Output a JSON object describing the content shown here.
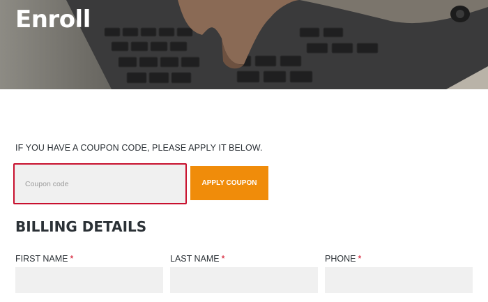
{
  "hero": {
    "title": "Enroll"
  },
  "coupon": {
    "prompt": "IF YOU HAVE A COUPON CODE, PLEASE APPLY IT BELOW.",
    "placeholder": "Coupon code",
    "value": "",
    "button_label": "APPLY COUPON",
    "button_color": "#f08c0a",
    "focus_border_color": "#c8102e"
  },
  "billing": {
    "title": "BILLING DETAILS",
    "required_marker": "*",
    "fields": [
      {
        "label": "FIRST NAME",
        "value": ""
      },
      {
        "label": "LAST NAME",
        "value": ""
      },
      {
        "label": "PHONE",
        "value": ""
      }
    ]
  }
}
